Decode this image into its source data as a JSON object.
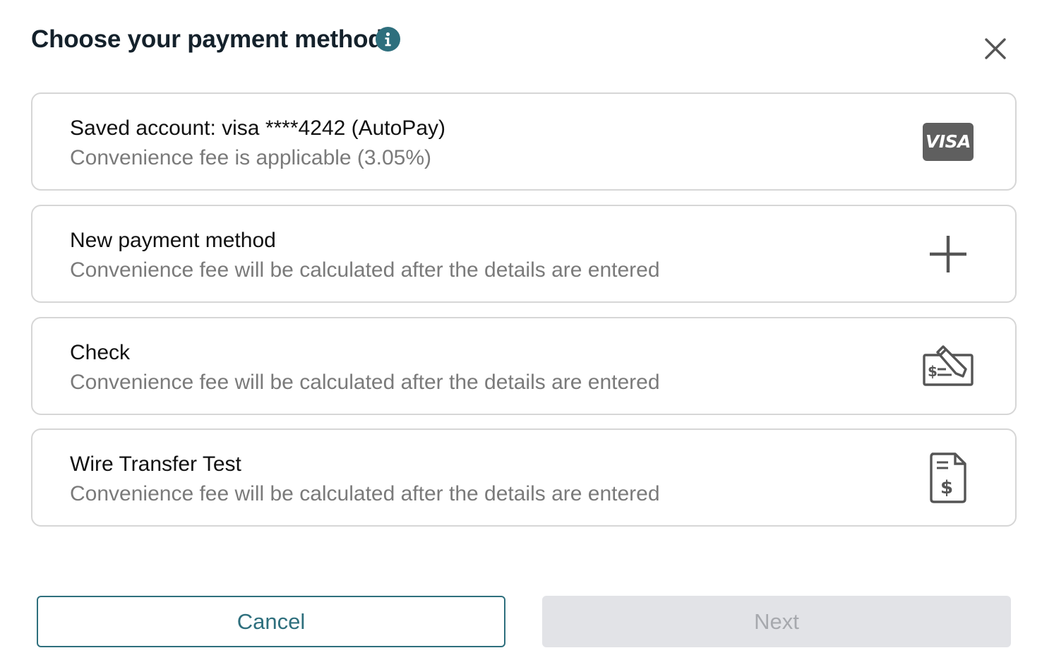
{
  "dialog": {
    "title": "Choose your payment method",
    "info_icon": "info-icon",
    "close_icon": "close-icon"
  },
  "options": [
    {
      "title": "Saved account: visa ****4242 (AutoPay)",
      "subtitle": "Convenience fee is applicable (3.05%)",
      "icon": "visa-card-icon",
      "badge_text": "VISA"
    },
    {
      "title": "New payment method",
      "subtitle": "Convenience fee will be calculated after the details are entered",
      "icon": "plus-icon"
    },
    {
      "title": "Check",
      "subtitle": "Convenience fee will be calculated after the details are entered",
      "icon": "check-icon"
    },
    {
      "title": "Wire Transfer Test",
      "subtitle": "Convenience fee will be calculated after the details are entered",
      "icon": "invoice-dollar-icon"
    }
  ],
  "buttons": {
    "cancel_label": "Cancel",
    "next_label": "Next"
  },
  "colors": {
    "accent": "#2e6f7d",
    "disabled_bg": "#e2e3e7",
    "disabled_text": "#a7a9ae",
    "border": "#d6d6d6",
    "subtext": "#7a7a7a",
    "icon_gray": "#5f5f5f"
  }
}
